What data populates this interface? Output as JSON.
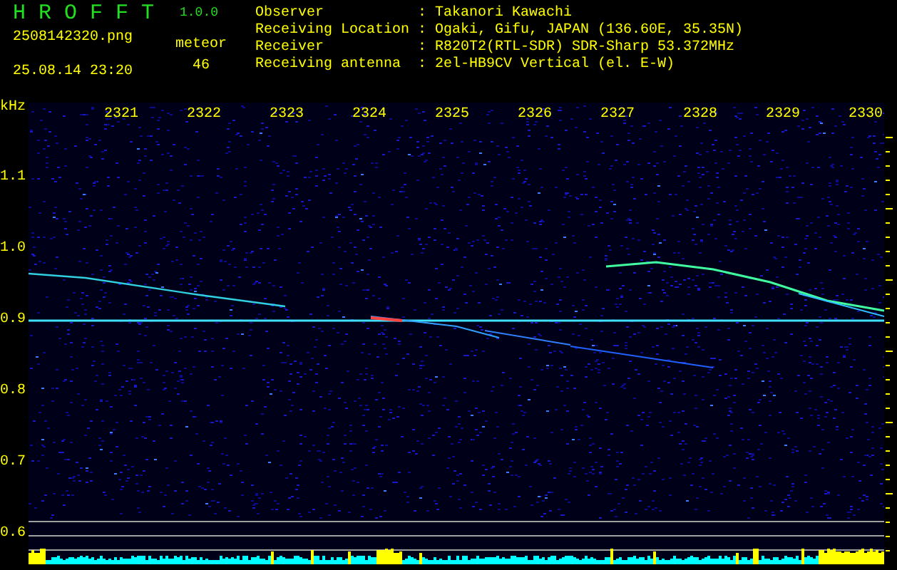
{
  "app": {
    "name": "H R O F F T",
    "version": "1.0.0"
  },
  "image": {
    "filename": "2508142320.png",
    "timestamp": "25.08.14 23:20"
  },
  "meteor": {
    "label": "meteor",
    "count": "46"
  },
  "info": [
    {
      "label": "Observer",
      "separator": ":",
      "value": "Takanori Kawachi"
    },
    {
      "label": "Receiving Location",
      "separator": ":",
      "value": "Ogaki, Gifu, JAPAN (136.60E, 35.35N)"
    },
    {
      "label": "Receiver",
      "separator": ":",
      "value": "R820T2(RTL-SDR) SDR-Sharp 53.372MHz"
    },
    {
      "label": "Receiving antenna",
      "separator": ":",
      "value": "2el-HB9CV Vertical (el. E-W)"
    }
  ],
  "spectrogram": {
    "y_unit": "kHz",
    "x_labels": [
      "2321",
      "2322",
      "2323",
      "2324",
      "2325",
      "2326",
      "2327",
      "2328",
      "2329",
      "2330"
    ],
    "y_labels": [
      "1.1",
      "1.0",
      "0.9",
      "0.8",
      "0.7",
      "0.6"
    ]
  }
}
